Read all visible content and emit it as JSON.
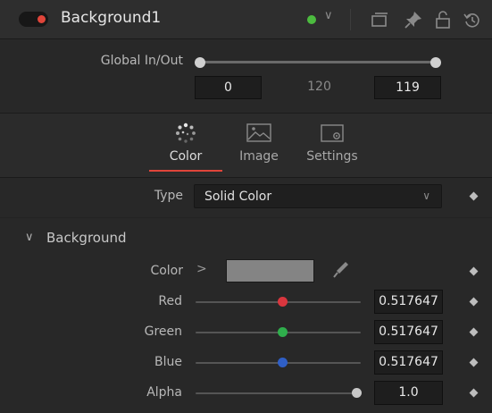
{
  "header": {
    "title": "Background1",
    "icons": [
      "power-toggle",
      "status-dot",
      "chevron-down-icon",
      "versions-icon",
      "pin-icon",
      "lock-icon",
      "reset-icon"
    ]
  },
  "global": {
    "label": "Global In/Out",
    "in": "0",
    "duration": "120",
    "out": "119"
  },
  "tabs": [
    {
      "label": "Color",
      "icon": "color-icon",
      "active": true
    },
    {
      "label": "Image",
      "icon": "image-icon",
      "active": false
    },
    {
      "label": "Settings",
      "icon": "settings-icon",
      "active": false
    }
  ],
  "type": {
    "label": "Type",
    "value": "Solid Color"
  },
  "section": {
    "label": "Background"
  },
  "color": {
    "label": "Color",
    "swatch": "#848484"
  },
  "channels": [
    {
      "label": "Red",
      "value": "0.517647",
      "knob_color": "#d9363e",
      "level": 0.517647
    },
    {
      "label": "Green",
      "value": "0.517647",
      "knob_color": "#2fae4c",
      "level": 0.517647
    },
    {
      "label": "Blue",
      "value": "0.517647",
      "knob_color": "#2f5fc6",
      "level": 0.517647
    },
    {
      "label": "Alpha",
      "value": "1.0",
      "knob_color": "#c8c8c8",
      "level": 1.0
    }
  ],
  "colors": {
    "accent": "#e0453a",
    "status": "#4cbb3f"
  }
}
